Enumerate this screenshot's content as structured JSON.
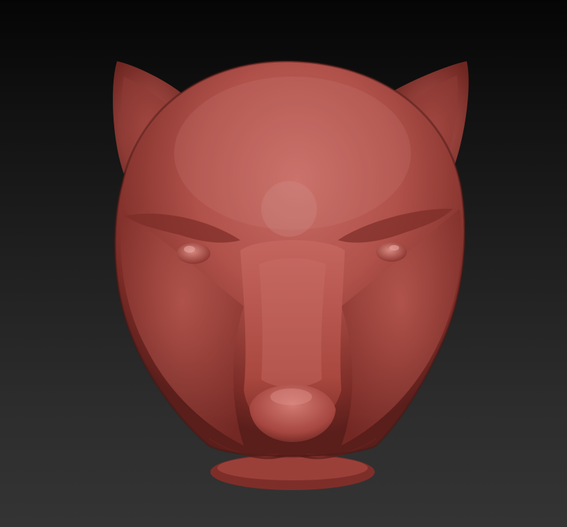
{
  "scene": {
    "subject": "panther-head-sculpt",
    "material_color": "#b0514a",
    "highlight_color": "#d8908a",
    "shadow_color": "#5a1e1b",
    "background_top": "#050505",
    "background_bottom": "#343434"
  }
}
